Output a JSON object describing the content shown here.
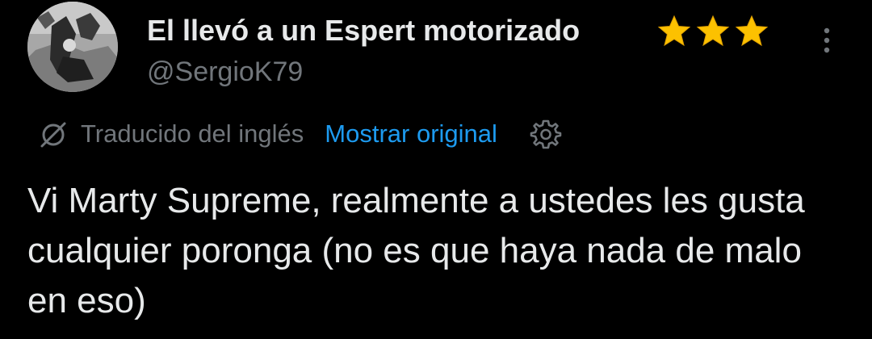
{
  "tweet": {
    "author": {
      "display_name": "El llevó a un Espert motorizado",
      "name_emoji_icons": [
        "star-icon",
        "star-icon",
        "star-icon"
      ],
      "username": "@SergioK79",
      "avatar": "avatar-photo"
    },
    "menu_icon": "more-options-icon",
    "translation": {
      "icon": "translate-icon",
      "label": "Traducido del inglés",
      "show_original_label": "Mostrar original",
      "settings_icon": "gear-icon"
    },
    "text": "Vi Marty Supreme, realmente a ustedes les gusta cualquier poronga (no es que haya nada de malo en eso)"
  },
  "colors": {
    "background": "#000000",
    "primary_text": "#e7e9ea",
    "secondary_text": "#71767b",
    "link": "#1d9bf0",
    "star": "#fcc100"
  }
}
